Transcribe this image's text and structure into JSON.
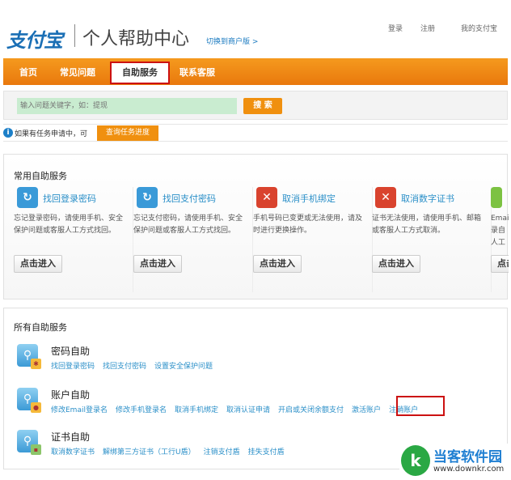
{
  "header": {
    "logo": "支付宝",
    "title": "个人帮助中心",
    "switch_link": "切换到商户版 >",
    "login": "登录",
    "register": "注册",
    "my_alipay": "我的支付宝"
  },
  "nav": {
    "items": [
      "首页",
      "常见问题",
      "自助服务",
      "联系客服"
    ],
    "active": "自助服务"
  },
  "search": {
    "placeholder": "输入问题关键字，如：提现",
    "button": "搜 索"
  },
  "task": {
    "text": "如果有任务申请中，可",
    "button": "查询任务进度"
  },
  "common": {
    "title": "常用自助服务",
    "button": "点击进入",
    "cards": [
      {
        "title": "找回登录密码",
        "desc": "忘记登录密码，请使用手机、安全保护问题或客服人工方式找回。",
        "icon": "lock-refresh-icon"
      },
      {
        "title": "找回支付密码",
        "desc": "忘记支付密码，请使用手机、安全保护问题或客服人工方式找回。",
        "icon": "key-refresh-icon"
      },
      {
        "title": "取消手机绑定",
        "desc": "手机号码已变更或无法使用，请及时进行更换操作。",
        "icon": "phone-cancel-icon"
      },
      {
        "title": "取消数字证书",
        "desc": "证书无法使用，请使用手机、邮箱或客服人工方式取消。",
        "icon": "cert-cancel-icon"
      },
      {
        "title": "",
        "desc": "Email 录自 人工",
        "icon": "email-icon"
      }
    ]
  },
  "all": {
    "title": "所有自助服务",
    "groups": [
      {
        "title": "密码自助",
        "links": [
          "找回登录密码",
          "找回支付密码",
          "设置安全保护问题"
        ]
      },
      {
        "title": "账户自助",
        "links": [
          "修改Email登录名",
          "修改手机登录名",
          "取消手机绑定",
          "取消认证申请",
          "开启或关闭余额支付",
          "激活账户",
          "注销账户"
        ]
      },
      {
        "title": "证书自助",
        "links": [
          "取消数字证书",
          "解绑第三方证书（工行U盾）",
          "注销支付盾",
          "挂失支付盾"
        ]
      }
    ]
  },
  "watermark": {
    "name": "当客软件园",
    "url": "www.downkr.com"
  }
}
